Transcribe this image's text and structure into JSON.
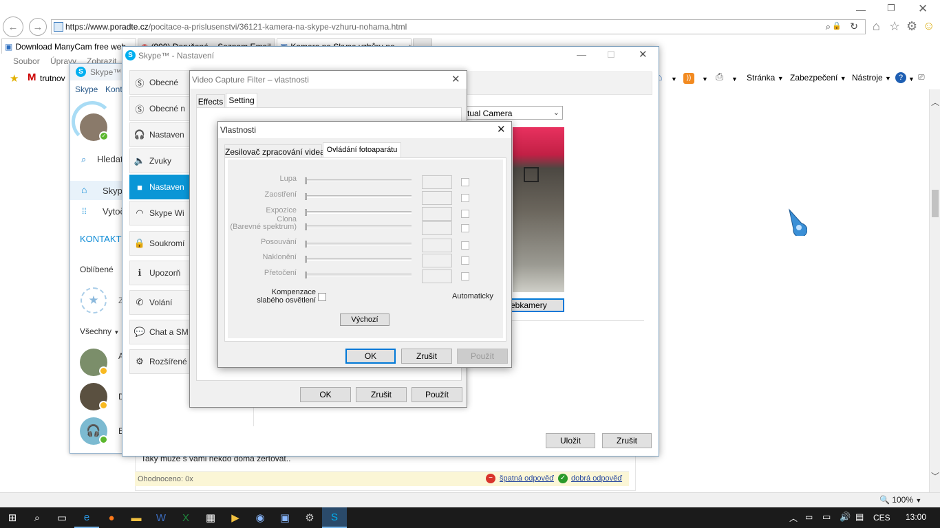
{
  "browser": {
    "url_prefix": "https://www.",
    "url_host": "poradte.cz",
    "url_path": "/pocitace-a-prislusenstvi/36121-kamera-na-skype-vzhuru-nohama.html",
    "tabs": [
      {
        "label": "Download ManyCam free web..."
      },
      {
        "label": "(909) Doručené – Seznam Email"
      },
      {
        "label": "Kamera na Skype vzhůru no..."
      }
    ],
    "menu": [
      "Soubor",
      "Úpravy",
      "Zobrazit"
    ],
    "favorite_label": "trutnov",
    "commands": {
      "page": "Stránka",
      "security": "Zabezpečení",
      "tools": "Nástroje"
    },
    "zoom": "100%"
  },
  "page": {
    "snippet": "Taky může s vámi někdo doma žertovat..",
    "rating": "Ohodnoceno: 0x",
    "bad_answer": "špatná odpověď",
    "good_answer": "dobrá odpověď"
  },
  "skype_main": {
    "title": "Skype™ -",
    "menu": [
      "Skype",
      "Kont"
    ],
    "search": "Hledat",
    "home": "Skyp",
    "dial": "Vytoč",
    "contacts": "KONTAKTY",
    "favorites": "Oblíbené",
    "fav_letter": "Z",
    "all": "Všechny",
    "contacts_letters": [
      "A",
      "D",
      "E"
    ]
  },
  "settings": {
    "title": "Skype™ - Nastavení",
    "items": [
      {
        "label": "Obecné",
        "icon": "skype-icon"
      },
      {
        "label": "Obecné n",
        "icon": "skype-icon"
      },
      {
        "label": "Nastaven",
        "icon": "headset-icon"
      },
      {
        "label": "Zvuky",
        "icon": "speaker-icon"
      },
      {
        "label": "Nastaven",
        "icon": "camera-icon",
        "active": true
      },
      {
        "label": "Skype Wi",
        "icon": "wifi-icon"
      },
      {
        "label": "Soukromí",
        "icon": "lock-icon"
      },
      {
        "label": "Upozorň",
        "icon": "info-icon"
      },
      {
        "label": "Volání",
        "icon": "phone-icon"
      },
      {
        "label": "Chat a SM",
        "icon": "chat-icon"
      },
      {
        "label": "Rozšířené",
        "icon": "gear-icon"
      }
    ],
    "camera_select": "tual Camera",
    "webcam_button": "ebkamery",
    "save": "Uložit",
    "cancel": "Zrušit"
  },
  "vcf": {
    "title": "Video Capture Filter – vlastnosti",
    "tabs": [
      "Effects",
      "Setting"
    ],
    "ok": "OK",
    "cancel": "Zrušit",
    "apply": "Použít"
  },
  "props": {
    "title": "Vlastnosti",
    "tabs": [
      "Zesilovač zpracování videa",
      "Ovládání fotoaparátu"
    ],
    "rows": [
      {
        "label": "Lupa"
      },
      {
        "label": "Zaostření"
      },
      {
        "label": "Expozice"
      },
      {
        "label": "Clona\n(Barevné spektrum)"
      },
      {
        "label": "Posouvání"
      },
      {
        "label": "Naklonění"
      },
      {
        "label": "Přetočení"
      }
    ],
    "low_light": "Kompenzace\nslabého osvětlení",
    "auto": "Automaticky",
    "default": "Výchozí",
    "ok": "OK",
    "cancel": "Zrušit",
    "apply": "Použít"
  },
  "taskbar": {
    "lang": "CES",
    "time": "13:00"
  }
}
